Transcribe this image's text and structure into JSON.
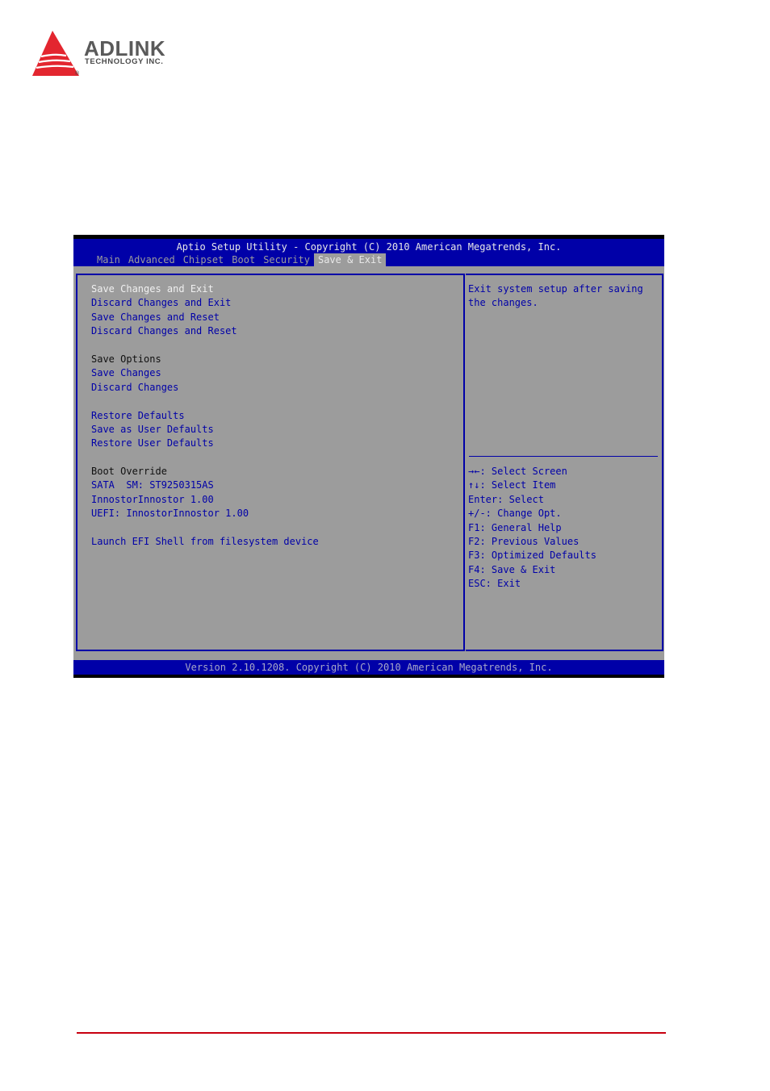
{
  "logo": {
    "name": "ADLINK",
    "subtitle": "TECHNOLOGY INC.",
    "registered": "®",
    "brand_color": "#e3262f"
  },
  "bios": {
    "title": "Aptio Setup Utility - Copyright (C) 2010 American Megatrends, Inc.",
    "tabs": [
      {
        "label": "Main",
        "active": false
      },
      {
        "label": "Advanced",
        "active": false
      },
      {
        "label": "Chipset",
        "active": false
      },
      {
        "label": "Boot",
        "active": false
      },
      {
        "label": "Security",
        "active": false
      },
      {
        "label": "Save & Exit",
        "active": true
      }
    ],
    "menu": {
      "items": [
        {
          "label": "Save Changes and Exit",
          "type": "selected"
        },
        {
          "label": "Discard Changes and Exit",
          "type": "option"
        },
        {
          "label": "Save Changes and Reset",
          "type": "option"
        },
        {
          "label": "Discard Changes and Reset",
          "type": "option"
        },
        {
          "label": "Save Options",
          "type": "header"
        },
        {
          "label": "Save Changes",
          "type": "option"
        },
        {
          "label": "Discard Changes",
          "type": "option"
        },
        {
          "label": "Restore Defaults",
          "type": "option"
        },
        {
          "label": "Save as User Defaults",
          "type": "option"
        },
        {
          "label": "Restore User Defaults",
          "type": "option"
        },
        {
          "label": "Boot Override",
          "type": "header"
        },
        {
          "label": "SATA  SM: ST9250315AS",
          "type": "option"
        },
        {
          "label": "InnostorInnostor 1.00",
          "type": "option"
        },
        {
          "label": "UEFI: InnostorInnostor 1.00",
          "type": "option"
        },
        {
          "label": "Launch EFI Shell from filesystem device",
          "type": "option"
        }
      ]
    },
    "help": {
      "description": "Exit system setup after saving the changes.",
      "keys": [
        {
          "key": "→←:",
          "action": "Select Screen"
        },
        {
          "key": "↑↓:",
          "action": "Select Item"
        },
        {
          "key": "Enter:",
          "action": "Select"
        },
        {
          "key": "+/-:",
          "action": "Change Opt."
        },
        {
          "key": "F1:",
          "action": "General Help"
        },
        {
          "key": "F2:",
          "action": "Previous Values"
        },
        {
          "key": "F3:",
          "action": "Optimized Defaults"
        },
        {
          "key": "F4:",
          "action": "Save & Exit"
        },
        {
          "key": "ESC:",
          "action": "Exit"
        }
      ]
    },
    "footer": "Version 2.10.1208. Copyright (C) 2010 American Megatrends, Inc.",
    "colors": {
      "blue": "#0000a8",
      "grey": "#9c9c9c",
      "highlight": "#f0f0f0"
    }
  }
}
